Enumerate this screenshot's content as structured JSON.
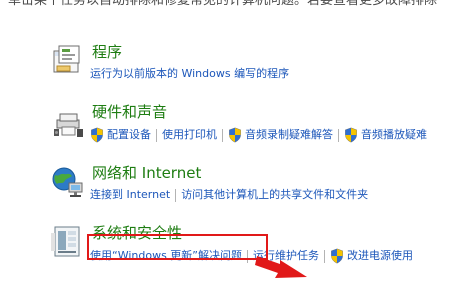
{
  "intro_text": "单击某个任务以自动排除和修复常见的计算机问题。若要查看更多故障排除",
  "categories": {
    "programs": {
      "title": "程序",
      "links": [
        "运行为以前版本的 Windows 编写的程序"
      ]
    },
    "hardware": {
      "title": "硬件和声音",
      "links": [
        "配置设备",
        "使用打印机",
        "音频录制疑难解答",
        "音频播放疑难"
      ]
    },
    "network": {
      "title": "网络和 Internet",
      "links": [
        "连接到 Internet",
        "访问其他计算机上的共享文件和文件夹"
      ]
    },
    "system": {
      "title": "系统和安全性",
      "links": [
        "使用“Windows 更新”解决问题",
        "运行维护任务",
        "改进电源使用"
      ]
    }
  },
  "colors": {
    "title_green": "#1e7d12",
    "link_blue": "#1d57ba",
    "highlight_red": "#e11919"
  },
  "icons": [
    "programs-icon",
    "hardware-sound-icon",
    "network-icon",
    "system-security-icon",
    "shield-icon"
  ]
}
